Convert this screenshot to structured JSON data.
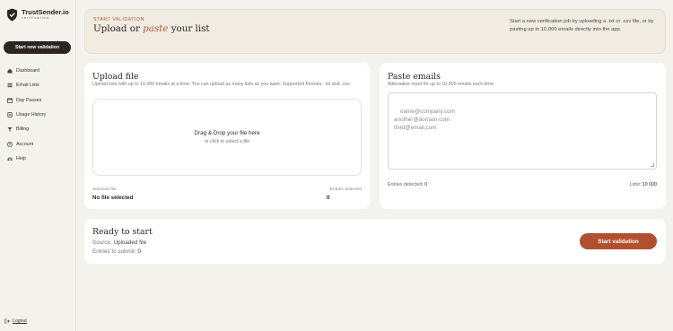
{
  "brand": {
    "name": "TrustSender.io",
    "tagline": "verification"
  },
  "sidebar": {
    "new_button": "Start new validation",
    "items": [
      {
        "label": "Dashboard",
        "icon": "home-icon"
      },
      {
        "label": "Email Lists",
        "icon": "list-icon"
      },
      {
        "label": "Day Passes",
        "icon": "calendar-icon"
      },
      {
        "label": "Usage History",
        "icon": "history-icon"
      },
      {
        "label": "Billing",
        "icon": "billing-icon"
      },
      {
        "label": "Account",
        "icon": "account-icon"
      },
      {
        "label": "Help",
        "icon": "help-icon"
      }
    ],
    "logout": "Logout"
  },
  "hero": {
    "eyebrow": "START VALIDATION",
    "title_before": "Upload or ",
    "title_emphasis": "paste",
    "title_after": " your list",
    "description": "Start a new verification job by uploading a .txt or .csv file, or by pasting up to 10,000 emails directly into the app."
  },
  "upload": {
    "title": "Upload file",
    "subtitle": "Upload lists with up to 10,000 emails at a time. You can upload as many lists as you want. Supported formats: .txt and .csv.",
    "dropzone_title": "Drag & Drop your file here",
    "dropzone_sub": "or click to select a file",
    "selected_label": "Selected file",
    "selected_value": "No file selected",
    "entries_label": "Entries detected",
    "entries_value": "0"
  },
  "paste": {
    "title": "Paste emails",
    "subtitle": "Alternative input for up to 10,000 emails each time.",
    "placeholder": "name@company.com\nanother@domain.com\nthird@email.com",
    "entries_label": "Entries detected: ",
    "entries_value": "0",
    "limit_label": "Limit: ",
    "limit_value": "10 000"
  },
  "ready": {
    "title": "Ready to start",
    "source_label": "Source: ",
    "source_value": "Uploaded file",
    "entries_label": "Entries to submit: ",
    "entries_value": "0",
    "button": "Start validation"
  },
  "colors": {
    "accent": "#b0502f",
    "dark": "#2a2522",
    "background": "#f4f2ec"
  }
}
